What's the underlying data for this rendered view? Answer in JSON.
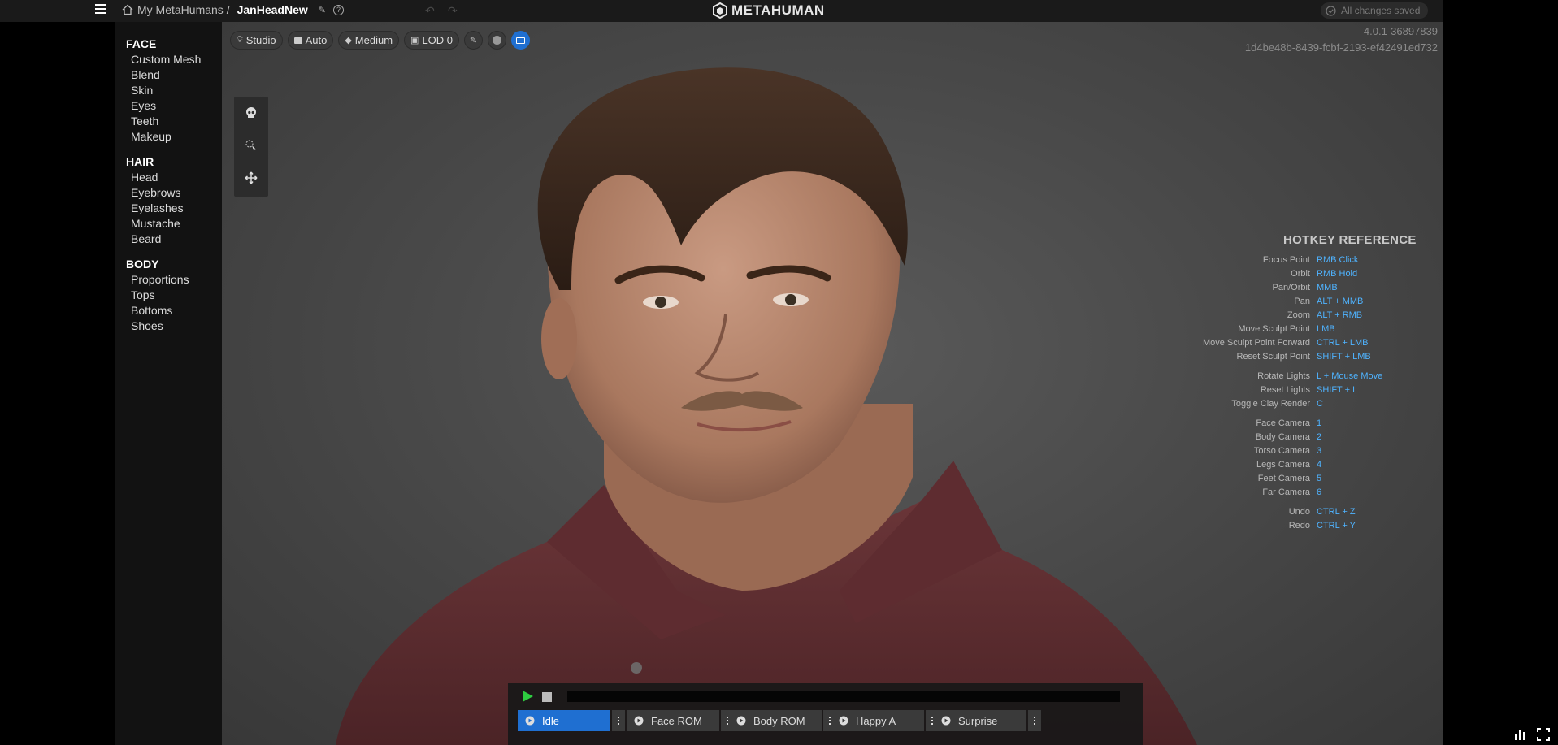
{
  "breadcrumb": {
    "root": "My MetaHumans /",
    "current": "JanHeadNew"
  },
  "logo": {
    "text": "METAHUMAN"
  },
  "status": {
    "saved": "All changes saved"
  },
  "sidebar": {
    "sections": [
      {
        "title": "FACE",
        "items": [
          "Custom Mesh",
          "Blend",
          "Skin",
          "Eyes",
          "Teeth",
          "Makeup"
        ]
      },
      {
        "title": "HAIR",
        "items": [
          "Head",
          "Eyebrows",
          "Eyelashes",
          "Mustache",
          "Beard"
        ]
      },
      {
        "title": "BODY",
        "items": [
          "Proportions",
          "Tops",
          "Bottoms",
          "Shoes"
        ]
      }
    ]
  },
  "viewport_toolbar": {
    "lighting": "Studio",
    "mode": "Auto",
    "quality": "Medium",
    "lod": "LOD 0"
  },
  "version": {
    "build": "4.0.1-36897839",
    "id": "1d4be48b-8439-fcbf-2193-ef42491ed732"
  },
  "hotkeys": {
    "title": "HOTKEY REFERENCE",
    "rows": [
      {
        "action": "Focus Point",
        "key": "RMB Click"
      },
      {
        "action": "Orbit",
        "key": "RMB Hold"
      },
      {
        "action": "Pan/Orbit",
        "key": "MMB"
      },
      {
        "action": "Pan",
        "key": "ALT + MMB"
      },
      {
        "action": "Zoom",
        "key": "ALT + RMB"
      },
      {
        "action": "Move Sculpt Point",
        "key": "LMB"
      },
      {
        "action": "Move Sculpt Point Forward",
        "key": "CTRL + LMB"
      },
      {
        "action": "Reset Sculpt Point",
        "key": "SHIFT + LMB"
      },
      {
        "action": "Rotate Lights",
        "key": "L + Mouse Move"
      },
      {
        "action": "Reset Lights",
        "key": "SHIFT + L"
      },
      {
        "action": "Toggle Clay Render",
        "key": "C"
      },
      {
        "action": "Face Camera",
        "key": "1"
      },
      {
        "action": "Body Camera",
        "key": "2"
      },
      {
        "action": "Torso Camera",
        "key": "3"
      },
      {
        "action": "Legs Camera",
        "key": "4"
      },
      {
        "action": "Feet Camera",
        "key": "5"
      },
      {
        "action": "Far Camera",
        "key": "6"
      },
      {
        "action": "Undo",
        "key": "CTRL + Z"
      },
      {
        "action": "Redo",
        "key": "CTRL + Y"
      }
    ]
  },
  "animation": {
    "clips": [
      "Idle",
      "Face ROM",
      "Body ROM",
      "Happy A",
      "Surprise"
    ],
    "selected": "Idle"
  },
  "colors": {
    "accent": "#1f6fd1",
    "hotkey": "#4fb3ff",
    "play": "#2ecc40"
  }
}
